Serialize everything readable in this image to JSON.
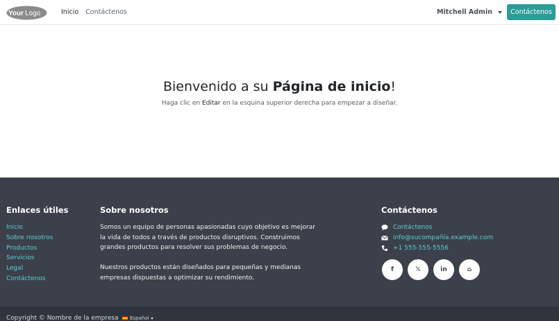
{
  "header": {
    "logo_text_1": "Your",
    "logo_text_2": "Logo",
    "nav": [
      {
        "label": "Inicio"
      },
      {
        "label": "Contáctenos"
      }
    ],
    "user_name": "Mitchell Admin",
    "cta_label": "Contáctenos"
  },
  "hero": {
    "title_prefix": "Bienvenido a su ",
    "title_bold": "Página de inicio",
    "title_suffix": "!",
    "subtitle_prefix": "Haga clic en ",
    "subtitle_em": "Editar",
    "subtitle_suffix": " en la esquina superior derecha para empezar a diseñar."
  },
  "footer": {
    "links_title": "Enlaces útiles",
    "links": [
      "Inicio",
      "Sobre nosotros",
      "Productos",
      "Servicios",
      "Legal",
      "Contáctenos"
    ],
    "about_title": "Sobre nosotros",
    "about_p1": "Somos un equipo de personas apasionadas cuyo objetivo es mejorar la vida de todos a través de productos disruptivos. Construimos grandes productos para resolver sus problemas de negocio.",
    "about_p2": "Nuestros productos están diseñados para pequeñas y medianas empresas dispuestas a optimizar su rendimiento.",
    "contact_title": "Contáctenos",
    "contact_link": "Contáctenos",
    "email": "info@sucompañía.example.com",
    "phone": "+1 555-555-5556",
    "socials": [
      {
        "icon": "facebook-icon",
        "glyph": "f"
      },
      {
        "icon": "x-twitter-icon",
        "glyph": "𝕏"
      },
      {
        "icon": "linkedin-icon",
        "glyph": "in"
      },
      {
        "icon": "home-icon",
        "glyph": "⌂"
      }
    ]
  },
  "copyright": {
    "text": "Copyright © Nombre de la empresa",
    "language": "Español"
  },
  "colors": {
    "accent": "#2a9d97",
    "link": "#5ccfd5",
    "footer_bg": "#3b404a",
    "copyright_bg": "#30343c"
  }
}
